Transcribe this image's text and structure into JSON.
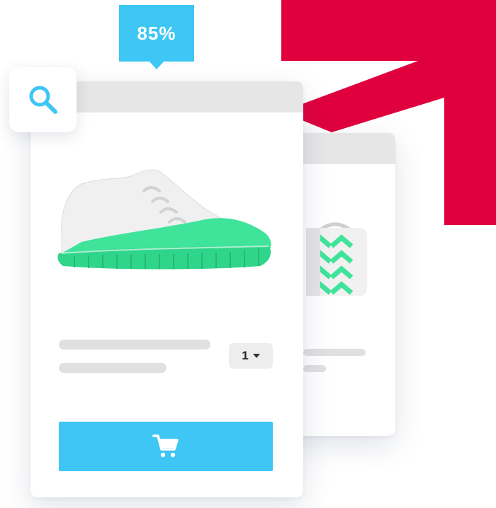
{
  "zoom_badge": {
    "value": "85%"
  },
  "product_card": {
    "quantity": "1",
    "quantity_options": [
      "1"
    ],
    "colors": {
      "accent": "#3ec6f4",
      "product_green": "#3fe39a",
      "brand_red": "#e0003e"
    }
  },
  "icons": {
    "search": "search-icon",
    "cart": "cart-icon",
    "dropdown": "chevron-down-icon",
    "arrow": "arrow-up-right-icon"
  }
}
